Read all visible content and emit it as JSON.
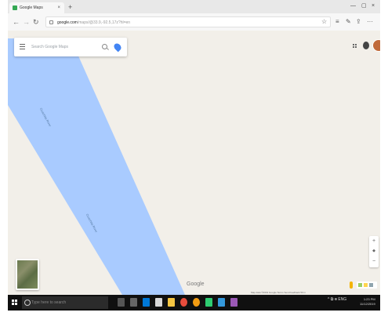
{
  "browser": {
    "tab_title": "Google Maps",
    "tab_close": "×",
    "new_tab": "+",
    "address_host": "google.com",
    "address_path": "/maps/@33.9,-92.5,17z?hl=en",
    "window_controls": [
      "—",
      "▢",
      "×"
    ]
  },
  "map": {
    "search_placeholder": "Search Google Maps",
    "river_labels": [
      "Ouachita River",
      "Ouachita River"
    ],
    "zoom_in": "+",
    "zoom_out": "−",
    "logo": "Google",
    "attribution": "Map data ©2019 Google   Terms   Send feedback   50 m"
  },
  "taskbar": {
    "search_placeholder": "Type here to search",
    "tray_text": "^ ⧉ ⊕ ENG",
    "time": "1:23 PM",
    "date": "11/12/2019"
  },
  "colors": {
    "river": "#a9cbff",
    "map_land": "#f2efe9",
    "taskbar": "#101010"
  },
  "icons": [
    "menu-icon",
    "search-icon",
    "directions-icon",
    "apps-icon",
    "notifications-icon",
    "account-avatar",
    "windows-start-icon"
  ]
}
